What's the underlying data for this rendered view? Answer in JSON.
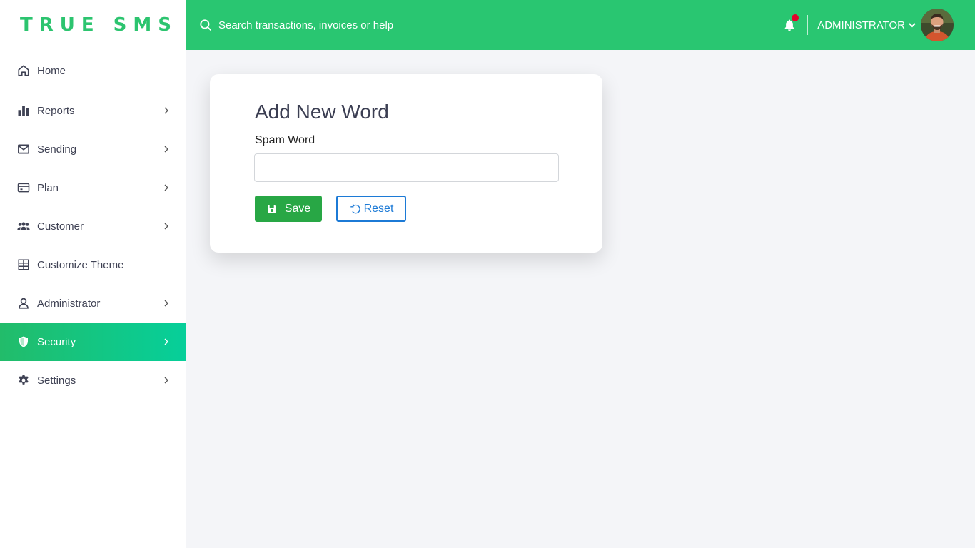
{
  "brand": "TRUE SMS",
  "search": {
    "placeholder": "Search transactions, invoices or help"
  },
  "user": {
    "name": "ADMINISTRATOR"
  },
  "sidebar": {
    "items": [
      {
        "label": "Home",
        "icon": "home-icon",
        "has_submenu": false
      },
      {
        "label": "Reports",
        "icon": "bar-chart-icon",
        "has_submenu": true
      },
      {
        "label": "Sending",
        "icon": "mail-icon",
        "has_submenu": true
      },
      {
        "label": "Plan",
        "icon": "credit-card-icon",
        "has_submenu": true
      },
      {
        "label": "Customer",
        "icon": "users-icon",
        "has_submenu": true
      },
      {
        "label": "Customize Theme",
        "icon": "grid-icon",
        "has_submenu": false
      },
      {
        "label": "Administrator",
        "icon": "user-icon",
        "has_submenu": true
      },
      {
        "label": "Security",
        "icon": "shield-icon",
        "has_submenu": true,
        "active": true
      },
      {
        "label": "Settings",
        "icon": "gear-icon",
        "has_submenu": true
      }
    ]
  },
  "form": {
    "title": "Add New Word",
    "field_label": "Spam Word",
    "field_value": "",
    "save_label": "Save",
    "reset_label": "Reset"
  },
  "colors": {
    "brand": "#2cc46f",
    "topbar": "#29c671",
    "active_gradient_start": "#22bc6a",
    "active_gradient_end": "#06cf9a",
    "save": "#28a745",
    "reset": "#1c7ad6",
    "notification_dot": "#e4002b"
  }
}
